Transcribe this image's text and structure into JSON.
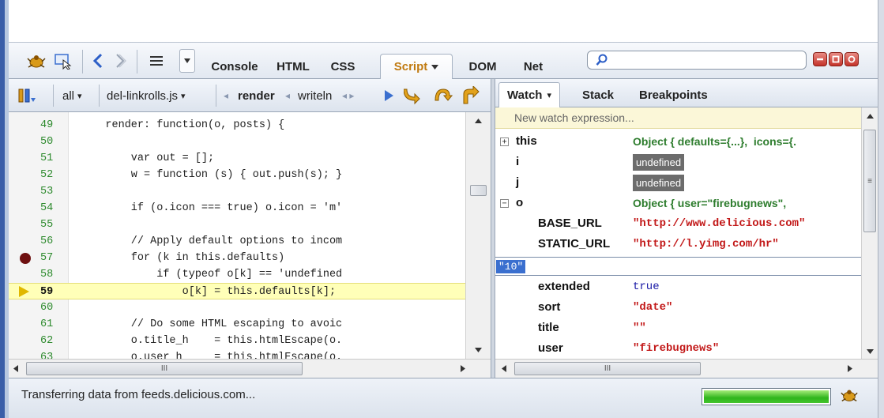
{
  "toolbar": {
    "tabs": [
      "Console",
      "HTML",
      "CSS",
      "Script",
      "DOM",
      "Net"
    ],
    "active_tab": "Script",
    "search": {
      "value": "",
      "placeholder": ""
    }
  },
  "script_bar": {
    "filter": "all",
    "file": "del-linkrolls.js",
    "callstack_current": "render",
    "callstack_next": "writeln"
  },
  "code": {
    "lines": [
      {
        "num": "49",
        "text": "    render: function(o, posts) {"
      },
      {
        "num": "50",
        "text": ""
      },
      {
        "num": "51",
        "text": "        var out = [];"
      },
      {
        "num": "52",
        "text": "        w = function (s) { out.push(s); }"
      },
      {
        "num": "53",
        "text": ""
      },
      {
        "num": "54",
        "text": "        if (o.icon === true) o.icon = 'm'"
      },
      {
        "num": "55",
        "text": ""
      },
      {
        "num": "56",
        "text": "        // Apply default options to incom"
      },
      {
        "num": "57",
        "text": "        for (k in this.defaults)"
      },
      {
        "num": "58",
        "text": "            if (typeof o[k] == 'undefined"
      },
      {
        "num": "59",
        "text": "                o[k] = this.defaults[k];"
      },
      {
        "num": "60",
        "text": ""
      },
      {
        "num": "61",
        "text": "        // Do some HTML escaping to avoic"
      },
      {
        "num": "62",
        "text": "        o.title_h    = this.htmlEscape(o."
      },
      {
        "num": "63",
        "text": "        o.user_h     = this.htmlEscape(o."
      }
    ],
    "breakpoint_line": "57",
    "current_line": "59"
  },
  "watch": {
    "tabs": [
      "Watch",
      "Stack",
      "Breakpoints"
    ],
    "active_tab": "Watch",
    "new_expression": "New watch expression...",
    "rows": [
      {
        "name": "this",
        "value": "Object { defaults={...},  icons={.",
        "type": "obj",
        "expandable": "+"
      },
      {
        "name": "i",
        "value": "undefined",
        "type": "undef"
      },
      {
        "name": "j",
        "value": "undefined",
        "type": "undef"
      },
      {
        "name": "o",
        "value": "Object { user=\"firebugnews\",",
        "type": "obj",
        "expandable": "−"
      },
      {
        "name": "BASE_URL",
        "value": "\"http://www.delicious.com\"",
        "type": "str"
      },
      {
        "name": "STATIC_URL",
        "value": "\"http://l.yimg.com/hr\"",
        "type": "str"
      }
    ],
    "editing_value": "\"10\"",
    "rows_after": [
      {
        "name": "extended",
        "value": "true",
        "type": "kw"
      },
      {
        "name": "sort",
        "value": "\"date\"",
        "type": "str"
      },
      {
        "name": "title",
        "value": "\"\"",
        "type": "str"
      },
      {
        "name": "user",
        "value": "\"firebugnews\"",
        "type": "str"
      }
    ]
  },
  "status": {
    "text": "Transferring data from feeds.delicious.com...",
    "progress": 1.0
  },
  "colors": {
    "accent": "#c07a10",
    "line_number": "#2d8a2d",
    "string": "#c21818",
    "object": "#2e7d2e",
    "current_line_bg": "#ffffb8",
    "breakpoint": "#6e1010"
  },
  "icons": [
    "firebug-icon",
    "inspect-icon",
    "back-icon",
    "forward-icon",
    "menu-icon",
    "dropdown-icon",
    "search-icon",
    "minimize-icon",
    "restore-icon",
    "close-icon",
    "pause-icon",
    "continue-icon",
    "step-over-icon",
    "step-into-icon",
    "step-out-icon"
  ]
}
